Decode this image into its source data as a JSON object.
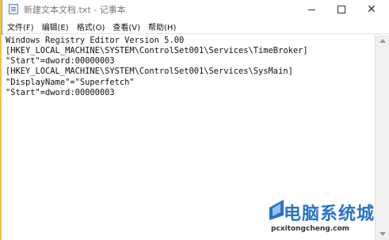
{
  "window": {
    "title": "新建文本文档.txt - 记事本"
  },
  "menu": {
    "items": [
      {
        "label": "文件(F)"
      },
      {
        "label": "编辑(E)"
      },
      {
        "label": "格式(O)"
      },
      {
        "label": "查看(V)"
      },
      {
        "label": "帮助(H)"
      }
    ]
  },
  "editor": {
    "lines": [
      "Windows Registry Editor Version 5.00",
      "[HKEY_LOCAL_MACHINE\\SYSTEM\\ControlSet001\\Services\\TimeBroker]",
      "\"Start\"=dword:00000003",
      "[HKEY_LOCAL_MACHINE\\SYSTEM\\ControlSet001\\Services\\SysMain]",
      "\"DisplayName\"=\"Superfetch\"",
      "\"Start\"=dword:00000003"
    ]
  },
  "watermark": {
    "main": "电脑系统城",
    "sub": "pcxitongcheng.com"
  },
  "colors": {
    "watermark_blue": "#2a72c9",
    "desktop_yellow": "#f0c24a"
  },
  "icons": {
    "app": "notepad-icon",
    "minimize": "minimize-icon",
    "maximize": "maximize-icon",
    "close": "close-icon"
  }
}
